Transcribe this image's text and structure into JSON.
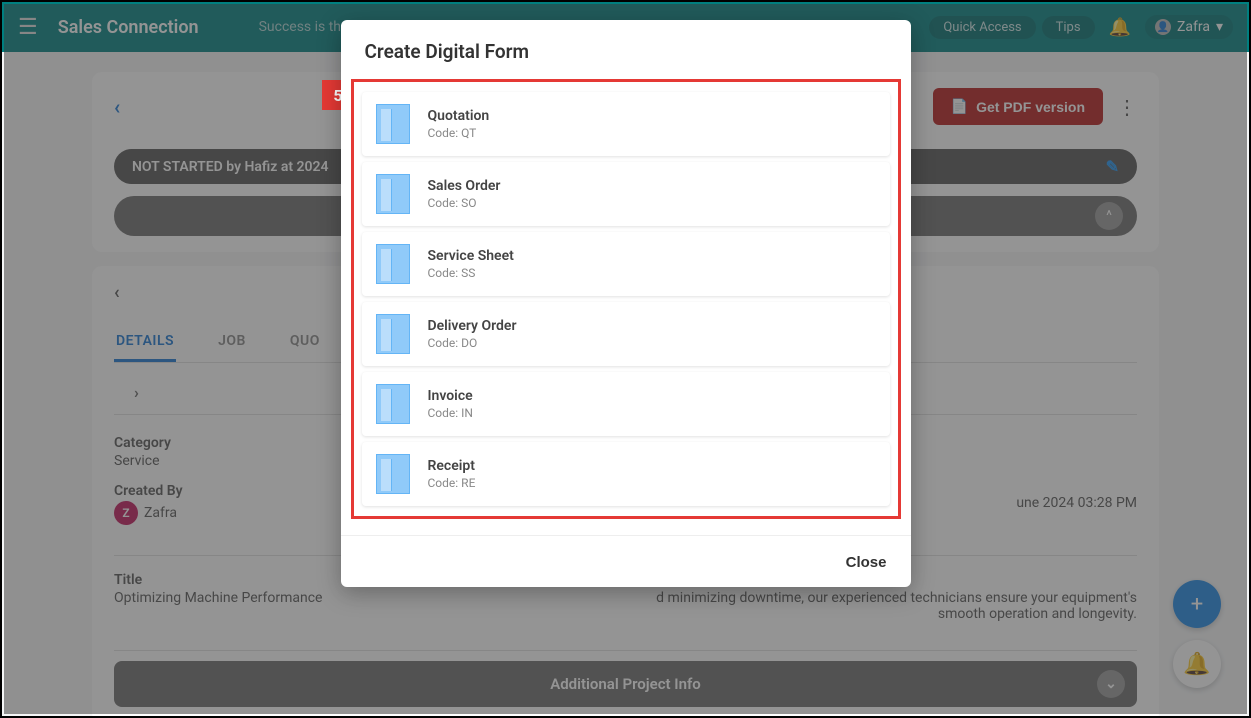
{
  "header": {
    "brand": "Sales Connection",
    "tagline": "Success is th",
    "quick_access": "Quick Access",
    "tips": "Tips",
    "user_name": "Zafra",
    "user_initial": "Z"
  },
  "card1": {
    "pdf_button": "Get PDF version",
    "status_text": "NOT STARTED by Hafiz at 2024"
  },
  "tabs": {
    "details": "DETAILS",
    "job": "JOB",
    "quo": "QUO"
  },
  "details": {
    "category_label": "Category",
    "category_value": "Service",
    "created_by_label": "Created By",
    "created_by_value": "Zafra",
    "created_by_initial": "Z",
    "date_value": "une 2024 03:28 PM",
    "title_label": "Title",
    "title_value": "Optimizing Machine Performance",
    "desc_tail": "d minimizing downtime, our experienced technicians ensure your equipment's smooth operation and longevity."
  },
  "additional_bar": "Additional Project Info",
  "modal": {
    "title": "Create Digital Form",
    "close": "Close",
    "step_badge": "5",
    "items": [
      {
        "title": "Quotation",
        "code": "Code: QT"
      },
      {
        "title": "Sales Order",
        "code": "Code: SO"
      },
      {
        "title": "Service Sheet",
        "code": "Code: SS"
      },
      {
        "title": "Delivery Order",
        "code": "Code: DO"
      },
      {
        "title": "Invoice",
        "code": "Code: IN"
      },
      {
        "title": "Receipt",
        "code": "Code: RE"
      }
    ]
  }
}
